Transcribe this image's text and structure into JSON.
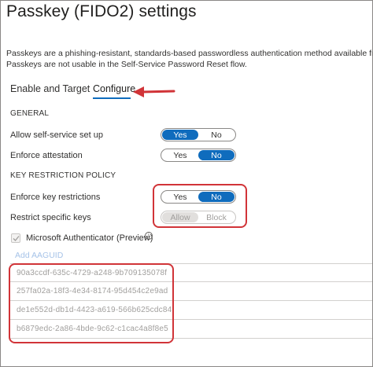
{
  "header": {
    "title": "Passkey (FIDO2) settings",
    "more": "···"
  },
  "description": {
    "line1": "Passkeys are a phishing-resistant, standards-based passwordless authentication method available from a va",
    "line2": "Passkeys are not usable in the Self-Service Password Reset flow."
  },
  "tabs": [
    {
      "label": "Enable and Target",
      "selected": false
    },
    {
      "label": "Configure",
      "selected": true
    }
  ],
  "general": {
    "heading": "GENERAL",
    "allow_self_service": {
      "label": "Allow self-service set up",
      "options": [
        "Yes",
        "No"
      ],
      "selected": "Yes"
    },
    "enforce_attestation": {
      "label": "Enforce attestation",
      "options": [
        "Yes",
        "No"
      ],
      "selected": "No"
    }
  },
  "key_restriction": {
    "heading": "KEY RESTRICTION POLICY",
    "enforce_key_restrictions": {
      "label": "Enforce key restrictions",
      "options": [
        "Yes",
        "No"
      ],
      "selected": "No"
    },
    "restrict_specific_keys": {
      "label": "Restrict specific keys",
      "options": [
        "Allow",
        "Block"
      ],
      "selected": "Allow",
      "disabled": true
    },
    "microsoft_authenticator": {
      "label": "Microsoft Authenticator (Preview)",
      "checked": true,
      "info": "i"
    },
    "add_aaguid": "Add AAGUID",
    "aaguids": [
      "90a3ccdf-635c-4729-a248-9b709135078f",
      "257fa02a-18f3-4e34-8174-95d454c2e9ad",
      "de1e552d-db1d-4423-a619-566b625cdc84",
      "b6879edc-2a86-4bde-9c62-c1cac4a8f8e5"
    ]
  },
  "colors": {
    "accent": "#0f6cbd",
    "annotation_red": "#d13438"
  },
  "icons": {
    "more": "ellipsis-icon",
    "arrow": "red-arrow-icon",
    "info": "info-icon",
    "check": "checkmark-icon"
  }
}
